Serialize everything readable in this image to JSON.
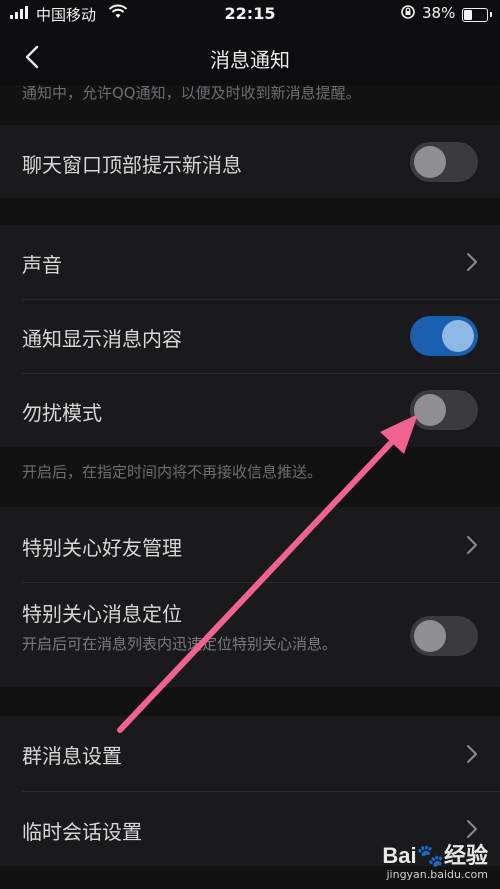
{
  "status_bar": {
    "carrier": "中国移动",
    "time": "22:15",
    "battery_percent": "38%",
    "battery_level": 0.38
  },
  "nav": {
    "title": "消息通知"
  },
  "top_hint": "通知中，允许QQ通知，以便及时收到新消息提醒。",
  "settings": {
    "chat_top_new": {
      "label": "聊天窗口顶部提示新消息",
      "enabled": false
    },
    "sound": {
      "label": "声音"
    },
    "show_content": {
      "label": "通知显示消息内容",
      "enabled": true
    },
    "dnd": {
      "label": "勿扰模式",
      "enabled": false,
      "hint": "开启后，在指定时间内将不再接收信息推送。"
    },
    "special_friends": {
      "label": "特别关心好友管理"
    },
    "special_locate": {
      "label": "特别关心消息定位",
      "desc": "开启后可在消息列表内迅速定位特别关心消息。",
      "enabled": false
    },
    "group_msg": {
      "label": "群消息设置"
    },
    "temp_chat": {
      "label": "临时会话设置"
    }
  },
  "watermark": {
    "brand": "Baiè®¡经验",
    "brand_left": "Bai",
    "brand_right": "经验",
    "site": "jingyan.baidu.com"
  },
  "colors": {
    "accent": "#1a5fb0",
    "annotation_arrow": "#f0628f"
  }
}
